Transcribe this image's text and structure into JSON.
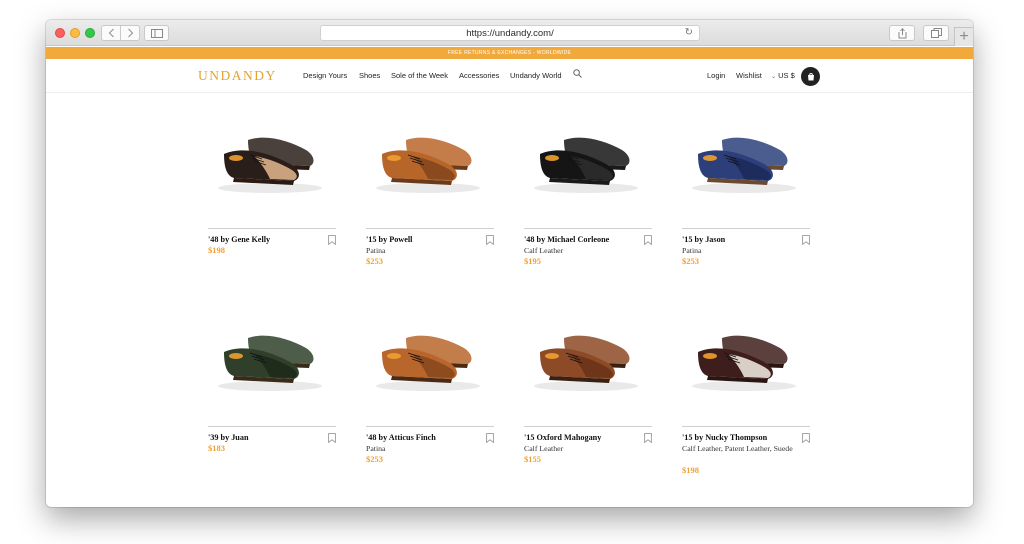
{
  "browser": {
    "url": "https://undandy.com/",
    "back_icon": "chevron-left-icon",
    "forward_icon": "chevron-right-icon",
    "sidebar_icon": "sidebar-icon",
    "share_icon": "share-icon",
    "tabs_icon": "tabs-icon",
    "new_tab_label": "+"
  },
  "promo": {
    "text": "FREE RETURNS & EXCHANGES - WORLDWIDE"
  },
  "header": {
    "logo": "UNDANDY",
    "nav": [
      "Design Yours",
      "Shoes",
      "Sole of the Week",
      "Accessories",
      "Undandy World"
    ],
    "login": "Login",
    "wishlist": "Wishlist",
    "currency": "US $"
  },
  "colors": {
    "accent": "#f0a030",
    "promo_bar": "#f2a93b",
    "logo": "#e2a42f"
  },
  "products": [
    {
      "name": "'48 by Gene Kelly",
      "material": "",
      "price": "$198",
      "upper": "#2a1e1a",
      "vamp": "#c9a27d",
      "sole": "#2a1a12"
    },
    {
      "name": "'15 by Powell",
      "material": "Patina",
      "price": "$253",
      "upper": "#b8652a",
      "vamp": "#8a4a1e",
      "sole": "#6b3a1a"
    },
    {
      "name": "'48 by Michael Corleone",
      "material": "Calf Leather",
      "price": "$195",
      "upper": "#151515",
      "vamp": "#2a2a2a",
      "sole": "#1a1a1a"
    },
    {
      "name": "'15 by Jason",
      "material": "Patina",
      "price": "$253",
      "upper": "#2c3f7a",
      "vamp": "#1d2c5c",
      "sole": "#6a4a30"
    },
    {
      "name": "'39 by Juan",
      "material": "",
      "price": "$183",
      "upper": "#2f3f2a",
      "vamp": "#1f2c1c",
      "sole": "#3a2a1a"
    },
    {
      "name": "'48 by Atticus Finch",
      "material": "Patina",
      "price": "$253",
      "upper": "#b8662c",
      "vamp": "#8e4c1e",
      "sole": "#4a2a14"
    },
    {
      "name": "'15 Oxford Mahogany",
      "material": "Calf Leather",
      "price": "$155",
      "upper": "#8c4a26",
      "vamp": "#6e3518",
      "sole": "#3a2010"
    },
    {
      "name": "'15 by Nucky Thompson",
      "material": "Calf Leather, Patent Leather, Suede",
      "price": "$198",
      "upper": "#3e1e1c",
      "vamp": "#d8cfc6",
      "sole": "#2a1512"
    }
  ]
}
